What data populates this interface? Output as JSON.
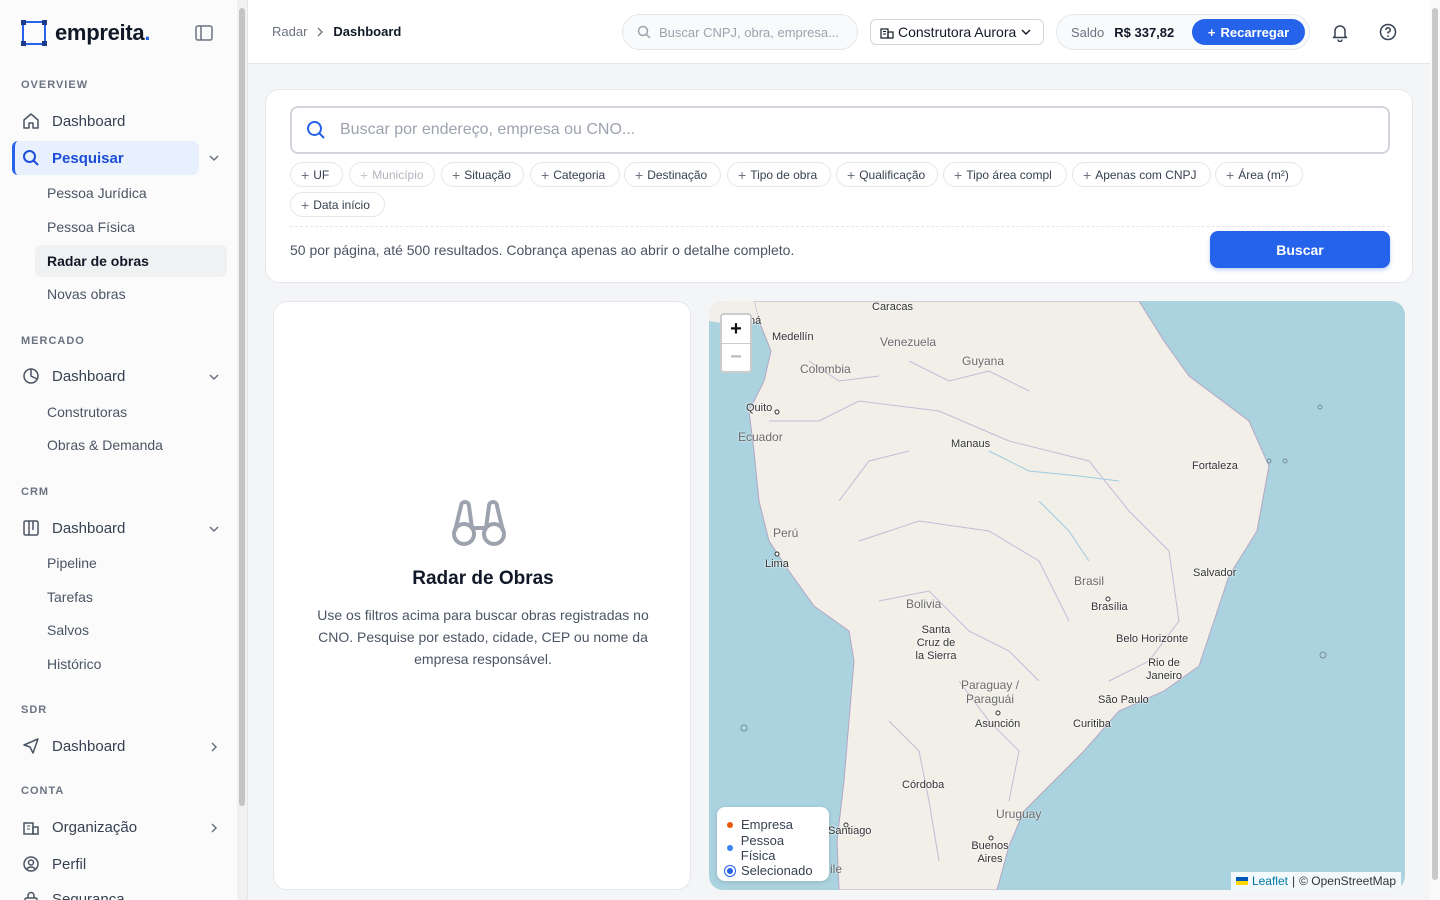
{
  "sidebar": {
    "logo": "empreita",
    "logo_dot": ".",
    "sections": {
      "overview": "OVERVIEW",
      "mercado": "MERCADO",
      "crm": "CRM",
      "sdr": "SDR",
      "conta": "CONTA"
    },
    "overview_items": {
      "dashboard": "Dashboard",
      "pesquisar": "Pesquisar",
      "pessoa_juridica": "Pessoa Jurídica",
      "pessoa_fisica": "Pessoa Física",
      "radar_de_obras": "Radar de obras",
      "novas_obras": "Novas obras"
    },
    "mercado_items": {
      "dashboard": "Dashboard",
      "construtoras": "Construtoras",
      "obras_demanda": "Obras & Demanda"
    },
    "crm_items": {
      "dashboard": "Dashboard",
      "pipeline": "Pipeline",
      "tarefas": "Tarefas",
      "salvos": "Salvos",
      "historico": "Histórico"
    },
    "sdr_items": {
      "dashboard": "Dashboard"
    },
    "conta_items": {
      "organizacao": "Organização",
      "perfil": "Perfil",
      "seguranca": "Segurança"
    }
  },
  "topbar": {
    "breadcrumb": [
      "Radar",
      "Dashboard"
    ],
    "search_placeholder": "Buscar CNPJ, obra, empresa...",
    "organization": "Construtora Aurora",
    "balance_label": "Saldo",
    "balance_value": "R$ 337,82",
    "recharge_label": "Recarregar"
  },
  "search": {
    "placeholder": "Buscar por endereço, empresa ou CNO...",
    "filters": [
      "UF",
      "Município",
      "Situação",
      "Categoria",
      "Destinação",
      "Tipo de obra",
      "Qualificação",
      "Tipo área compl",
      "Apenas com CNPJ",
      "Área (m²)",
      "Data início"
    ],
    "note": "50 por página, até 500 resultados. Cobrança apenas ao abrir o detalhe completo.",
    "button": "Buscar"
  },
  "empty_state": {
    "title": "Radar de Obras",
    "description": "Use os filtros acima para buscar obras registradas no CNO. Pesquise por estado, cidade, CEP ou nome da empresa responsável."
  },
  "map": {
    "zoom_in": "+",
    "zoom_out": "−",
    "legend": {
      "empresa": "Empresa",
      "pessoa_fisica": "Pessoa Física",
      "selecionado": "Selecionado"
    },
    "legend_colors": {
      "empresa": "#e8590c",
      "pessoa_fisica": "#3b82f6",
      "selecionado": "#2563eb"
    },
    "attribution_link": "Leaflet",
    "attribution_text": "© OpenStreetMap",
    "cities": {
      "caracas": "Caracas",
      "medellin": "Medellín",
      "panama": "ná",
      "quito": "Quito",
      "manaus": "Manaus",
      "fortaleza": "Fortaleza",
      "lima": "Lima",
      "salvador": "Salvador",
      "brasilia": "Brasília",
      "santa_cruz": "Santa Cruz de la Sierra",
      "belo_horizonte": "Belo Horizonte",
      "rio": "Rio de Janeiro",
      "sao_paulo": "São Paulo",
      "asuncion": "Asunción",
      "curitiba": "Curitiba",
      "cordoba": "Córdoba",
      "santiago": "Santiago",
      "buenos_aires": "Buenos Aires"
    },
    "countries": {
      "venezuela": "Venezuela",
      "guyana": "Guyana",
      "colombia": "Colombia",
      "ecuador": "Ecuador",
      "peru": "Perú",
      "brasil": "Brasil",
      "bolivia": "Bolivia",
      "paraguay": "Paraguay / Paraguái",
      "uruguay": "Uruguay",
      "chile": "ile"
    }
  },
  "colors": {
    "accent": "#2563eb",
    "ocean": "#aad3df",
    "land": "#f2efe9"
  }
}
